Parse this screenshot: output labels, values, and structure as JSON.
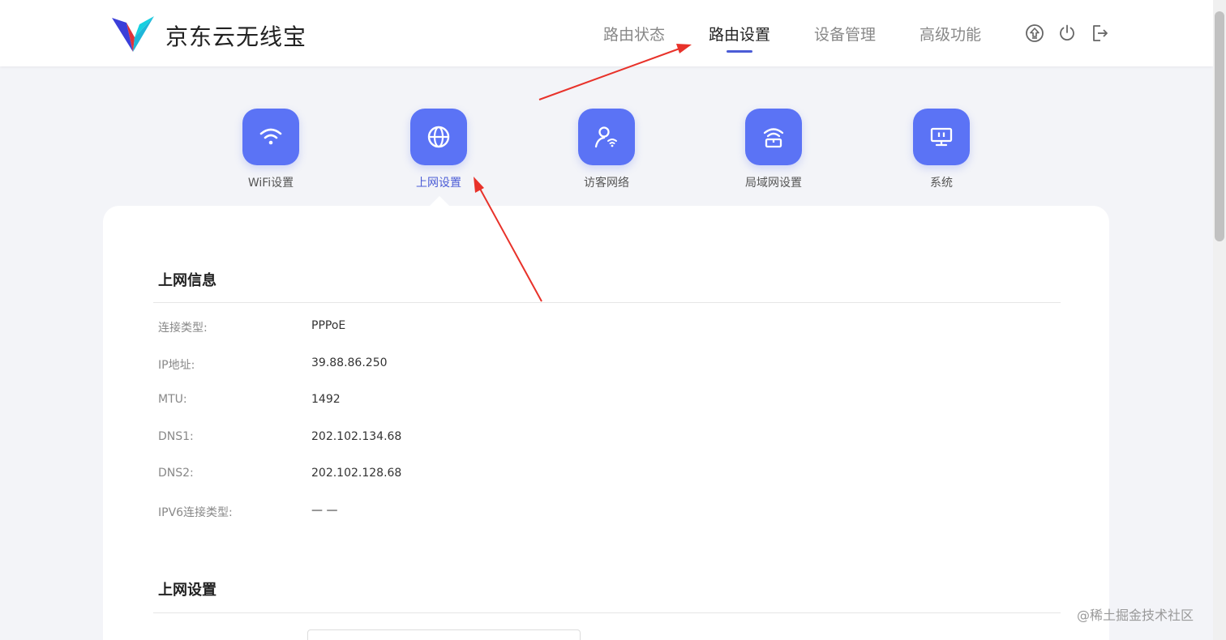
{
  "brand": {
    "name": "京东云无线宝"
  },
  "nav": {
    "items": [
      {
        "label": "路由状态"
      },
      {
        "label": "路由设置"
      },
      {
        "label": "设备管理"
      },
      {
        "label": "高级功能"
      }
    ],
    "active": "路由设置"
  },
  "header_icons": [
    "upgrade-icon",
    "power-icon",
    "logout-icon"
  ],
  "categories": [
    {
      "label": "WiFi设置",
      "icon": "wifi-icon"
    },
    {
      "label": "上网设置",
      "icon": "globe-icon"
    },
    {
      "label": "访客网络",
      "icon": "guest-network-icon"
    },
    {
      "label": "局域网设置",
      "icon": "lan-icon"
    },
    {
      "label": "系统",
      "icon": "monitor-icon"
    }
  ],
  "active_category": "上网设置",
  "internet_info": {
    "title": "上网信息",
    "rows": [
      {
        "label": "连接类型:",
        "value": "PPPoE"
      },
      {
        "label": "IP地址:",
        "value": "39.88.86.250"
      },
      {
        "label": "MTU:",
        "value": "1492"
      },
      {
        "label": "DNS1:",
        "value": "202.102.134.68"
      },
      {
        "label": "DNS2:",
        "value": "202.102.128.68"
      },
      {
        "label": "IPV6连接类型:",
        "value": "— —"
      }
    ]
  },
  "internet_settings": {
    "title": "上网设置"
  },
  "watermark": "@稀土掘金技术社区",
  "colors": {
    "accent": "#5b73f5",
    "active_text": "#4b5cd6",
    "annotation": "#e8322a"
  }
}
